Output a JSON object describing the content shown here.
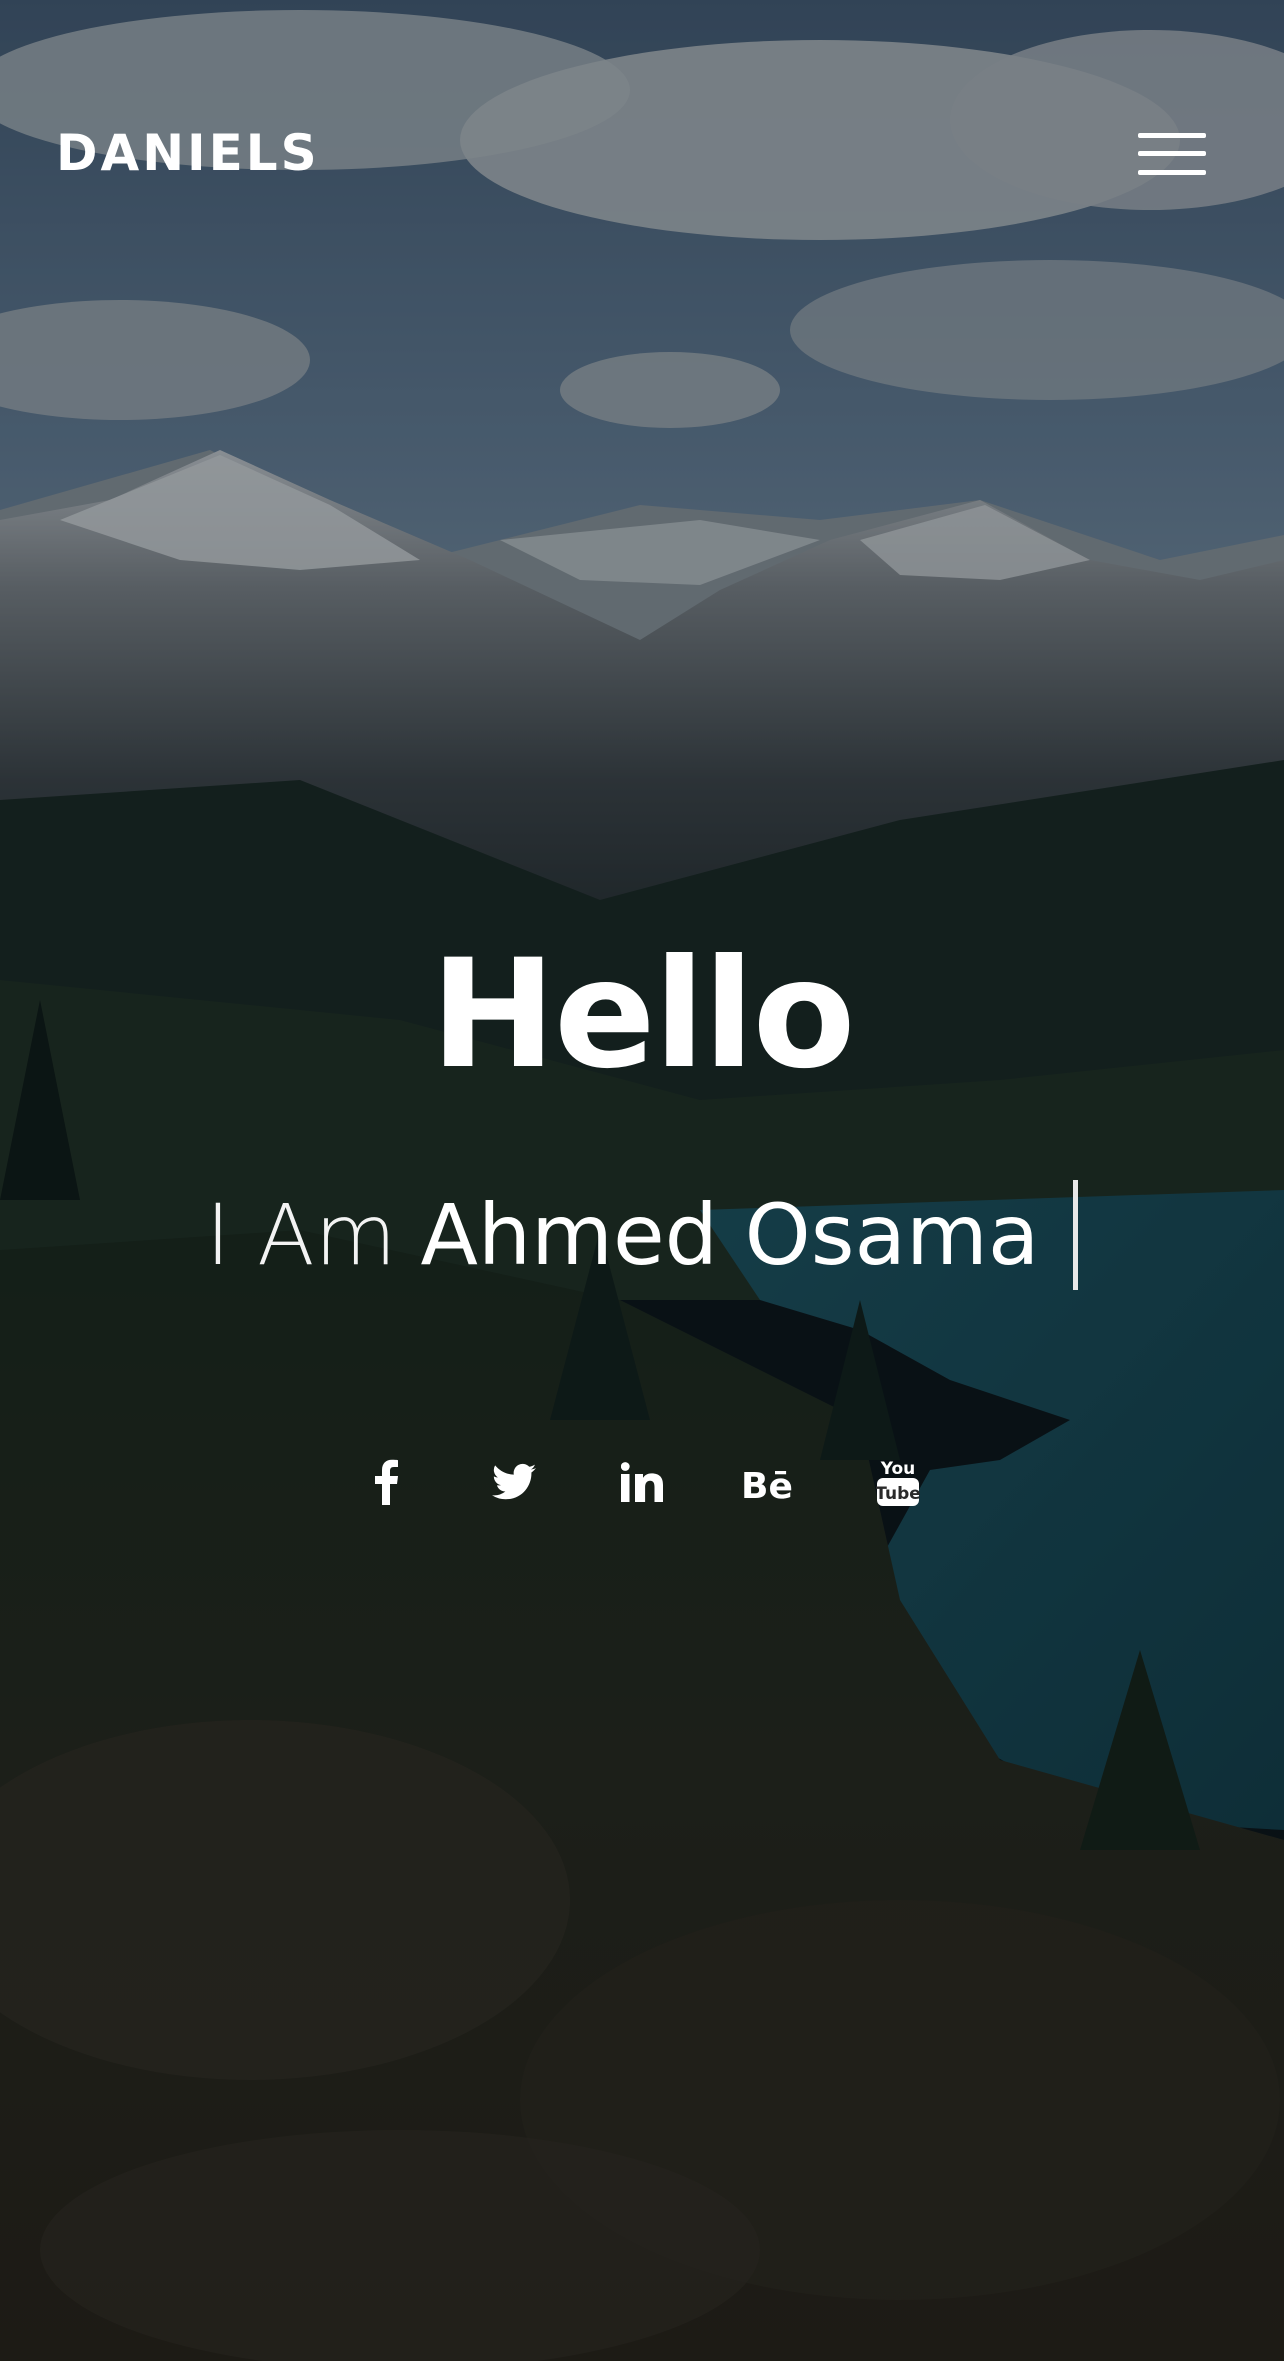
{
  "header": {
    "logo": "DANIELS",
    "menu_icon": "hamburger-menu-icon"
  },
  "hero": {
    "title": "Hello",
    "intro_prefix": "I Am",
    "intro_name": "Ahmed Osama",
    "background": "mountain-lake-landscape-photo"
  },
  "socials": [
    {
      "icon": "facebook-icon"
    },
    {
      "icon": "twitter-icon"
    },
    {
      "icon": "linkedin-icon"
    },
    {
      "icon": "behance-icon",
      "glyph": "Bē"
    },
    {
      "icon": "youtube-icon",
      "glyph_top": "You",
      "glyph_bottom": "Tube"
    }
  ],
  "colors": {
    "text": "#ffffff",
    "overlay": "#060c12"
  }
}
